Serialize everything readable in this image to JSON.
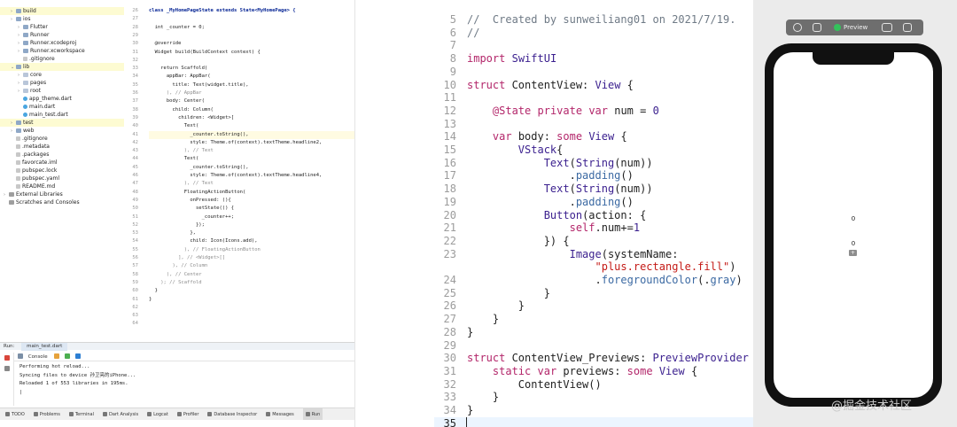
{
  "project_tree": [
    {
      "indent": 1,
      "arrow": "›",
      "icon": "folder",
      "label": "build",
      "selected": true
    },
    {
      "indent": 1,
      "arrow": "›",
      "icon": "folder",
      "label": "ios",
      "selected": false
    },
    {
      "indent": 2,
      "arrow": "›",
      "icon": "folder",
      "label": "Flutter",
      "selected": false
    },
    {
      "indent": 2,
      "arrow": "›",
      "icon": "folder",
      "label": "Runner",
      "selected": false
    },
    {
      "indent": 2,
      "arrow": "›",
      "icon": "folder",
      "label": "Runner.xcodeproj",
      "selected": false
    },
    {
      "indent": 2,
      "arrow": "›",
      "icon": "folder",
      "label": "Runner.xcworkspace",
      "selected": false
    },
    {
      "indent": 2,
      "arrow": "",
      "icon": "file",
      "label": ".gitignore",
      "selected": false
    },
    {
      "indent": 1,
      "arrow": "⌄",
      "icon": "folder",
      "label": "lib",
      "selected": true
    },
    {
      "indent": 2,
      "arrow": "›",
      "icon": "pkg",
      "label": "core",
      "selected": false
    },
    {
      "indent": 2,
      "arrow": "›",
      "icon": "pkg",
      "label": "pages",
      "selected": false
    },
    {
      "indent": 2,
      "arrow": "›",
      "icon": "pkg",
      "label": "root",
      "selected": false
    },
    {
      "indent": 2,
      "arrow": "",
      "icon": "dart",
      "label": "app_theme.dart",
      "selected": false
    },
    {
      "indent": 2,
      "arrow": "",
      "icon": "dart",
      "label": "main.dart",
      "selected": false
    },
    {
      "indent": 2,
      "arrow": "",
      "icon": "dart",
      "label": "main_test.dart",
      "selected": false
    },
    {
      "indent": 1,
      "arrow": "›",
      "icon": "folder",
      "label": "test",
      "selected": true
    },
    {
      "indent": 1,
      "arrow": "›",
      "icon": "folder",
      "label": "web",
      "selected": false
    },
    {
      "indent": 1,
      "arrow": "",
      "icon": "file",
      "label": ".gitignore",
      "selected": false
    },
    {
      "indent": 1,
      "arrow": "",
      "icon": "file",
      "label": ".metadata",
      "selected": false
    },
    {
      "indent": 1,
      "arrow": "",
      "icon": "file",
      "label": ".packages",
      "selected": false
    },
    {
      "indent": 1,
      "arrow": "",
      "icon": "file",
      "label": "favorcate.iml",
      "selected": false
    },
    {
      "indent": 1,
      "arrow": "",
      "icon": "file",
      "label": "pubspec.lock",
      "selected": false
    },
    {
      "indent": 1,
      "arrow": "",
      "icon": "file",
      "label": "pubspec.yaml",
      "selected": false
    },
    {
      "indent": 1,
      "arrow": "",
      "icon": "file",
      "label": "README.md",
      "selected": false
    },
    {
      "indent": 0,
      "arrow": "›",
      "icon": "lib",
      "label": "External Libraries",
      "selected": false
    },
    {
      "indent": 0,
      "arrow": "",
      "icon": "lib",
      "label": "Scratches and Consoles",
      "selected": false
    }
  ],
  "dart_editor": {
    "line_numbers": [
      "26",
      "27",
      "28",
      "29",
      "30",
      "31",
      "32",
      "33",
      "34",
      "35",
      "36",
      "37",
      "38",
      "39",
      "40",
      "41",
      "42",
      "43",
      "44",
      "45",
      "46",
      "47",
      "48",
      "49",
      "50",
      "51",
      "52",
      "53",
      "54",
      "55",
      "56",
      "57",
      "58",
      "59",
      "60",
      "61",
      "62",
      "63",
      "64"
    ],
    "lines": [
      {
        "text": "class _MyHomePageState extends State<MyHomePage> {",
        "style": "kw",
        "highlight": false
      },
      {
        "text": "",
        "style": "",
        "highlight": false
      },
      {
        "text": "  int _counter = 0;",
        "style": "",
        "highlight": false
      },
      {
        "text": "",
        "style": "",
        "highlight": false
      },
      {
        "text": "  @override",
        "style": "",
        "highlight": false
      },
      {
        "text": "  Widget build(BuildContext context) {",
        "style": "",
        "highlight": false
      },
      {
        "text": "",
        "style": "",
        "highlight": false
      },
      {
        "text": "    return Scaffold(",
        "style": "",
        "highlight": false
      },
      {
        "text": "      appBar: AppBar(",
        "style": "",
        "highlight": false
      },
      {
        "text": "        title: Text(widget.title),",
        "style": "",
        "highlight": false
      },
      {
        "text": "      ), // AppBar",
        "style": "cm",
        "highlight": false
      },
      {
        "text": "      body: Center(",
        "style": "",
        "highlight": false
      },
      {
        "text": "        child: Column(",
        "style": "",
        "highlight": false
      },
      {
        "text": "          children: <Widget>[",
        "style": "",
        "highlight": false
      },
      {
        "text": "            Text(",
        "style": "",
        "highlight": false
      },
      {
        "text": "              _counter.toString(),",
        "style": "",
        "highlight": true
      },
      {
        "text": "              style: Theme.of(context).textTheme.headline2,",
        "style": "",
        "highlight": false
      },
      {
        "text": "            ), // Text",
        "style": "cm",
        "highlight": false
      },
      {
        "text": "            Text(",
        "style": "",
        "highlight": false
      },
      {
        "text": "              _counter.toString(),",
        "style": "",
        "highlight": false
      },
      {
        "text": "              style: Theme.of(context).textTheme.headline4,",
        "style": "",
        "highlight": false
      },
      {
        "text": "            ), // Text",
        "style": "cm",
        "highlight": false
      },
      {
        "text": "            FloatingActionButton(",
        "style": "",
        "highlight": false
      },
      {
        "text": "              onPressed: (){",
        "style": "",
        "highlight": false
      },
      {
        "text": "                setState(() {",
        "style": "",
        "highlight": false
      },
      {
        "text": "                  _counter++;",
        "style": "",
        "highlight": false
      },
      {
        "text": "                });",
        "style": "",
        "highlight": false
      },
      {
        "text": "              },",
        "style": "",
        "highlight": false
      },
      {
        "text": "              child: Icon(Icons.add),",
        "style": "",
        "highlight": false
      },
      {
        "text": "            ), // FloatingActionButton",
        "style": "cm",
        "highlight": false
      },
      {
        "text": "          ], // <Widget>[]",
        "style": "cm",
        "highlight": false
      },
      {
        "text": "        ), // Column",
        "style": "cm",
        "highlight": false
      },
      {
        "text": "      ), // Center",
        "style": "cm",
        "highlight": false
      },
      {
        "text": "    ); // Scaffold",
        "style": "cm",
        "highlight": false
      },
      {
        "text": "  }",
        "style": "",
        "highlight": false
      },
      {
        "text": "}",
        "style": "",
        "highlight": false
      },
      {
        "text": "",
        "style": "",
        "highlight": false
      },
      {
        "text": "",
        "style": "",
        "highlight": false
      },
      {
        "text": "",
        "style": "",
        "highlight": false
      }
    ]
  },
  "run_panel": {
    "run_label": "Run:",
    "run_tab": "main_test.dart",
    "console_label": "Console",
    "console_lines": [
      "Performing hot reload...",
      "Syncing files to device 孙卫亮的iPhone...",
      "Reloaded 1 of 553 libraries in 195ms.",
      "|"
    ]
  },
  "bottom_tabs": [
    "TODO",
    "Problems",
    "Terminal",
    "Dart Analysis",
    "Logcat",
    "Profiler",
    "Database Inspector",
    "Messages",
    "Run"
  ],
  "bottom_active_tab": "Run",
  "swift_editor": {
    "lines": [
      {
        "num": "5",
        "text": "//  Created by sunweiliang01 on 2021/7/19."
      },
      {
        "num": "6",
        "text": "//"
      },
      {
        "num": "7",
        "text": ""
      },
      {
        "num": "8",
        "text": "import SwiftUI"
      },
      {
        "num": "9",
        "text": ""
      },
      {
        "num": "10",
        "text": "struct ContentView: View {"
      },
      {
        "num": "11",
        "text": ""
      },
      {
        "num": "12",
        "text": "    @State private var num = 0"
      },
      {
        "num": "13",
        "text": ""
      },
      {
        "num": "14",
        "text": "    var body: some View {"
      },
      {
        "num": "15",
        "text": "        VStack{"
      },
      {
        "num": "16",
        "text": "            Text(String(num))"
      },
      {
        "num": "17",
        "text": "                .padding()"
      },
      {
        "num": "18",
        "text": "            Text(String(num))"
      },
      {
        "num": "19",
        "text": "                .padding()"
      },
      {
        "num": "20",
        "text": "            Button(action: {"
      },
      {
        "num": "21",
        "text": "                self.num+=1"
      },
      {
        "num": "22",
        "text": "            }) {"
      },
      {
        "num": "23",
        "text": "                Image(systemName:"
      },
      {
        "num": "",
        "text": "                    \"plus.rectangle.fill\")"
      },
      {
        "num": "24",
        "text": "                    .foregroundColor(.gray)"
      },
      {
        "num": "25",
        "text": "            }"
      },
      {
        "num": "26",
        "text": "        }"
      },
      {
        "num": "27",
        "text": "    }"
      },
      {
        "num": "28",
        "text": "}"
      },
      {
        "num": "29",
        "text": ""
      },
      {
        "num": "30",
        "text": "struct ContentView_Previews: PreviewProvider {"
      },
      {
        "num": "31",
        "text": "    static var previews: some View {"
      },
      {
        "num": "32",
        "text": "        ContentView()"
      },
      {
        "num": "33",
        "text": "    }"
      },
      {
        "num": "34",
        "text": "}"
      },
      {
        "num": "35",
        "text": ""
      }
    ],
    "current_line": "35"
  },
  "preview": {
    "toolbar_label": "Preview",
    "counter_1": "0",
    "counter_2": "0",
    "plus_icon": "plus-rectangle-fill-icon"
  },
  "watermark": "@掘金技术社区",
  "colors": {
    "keyword": "#b3266a",
    "type": "#3a1f8e",
    "string": "#c41a16",
    "comment": "#6f7a86",
    "preview_green": "#33c25b",
    "selected_row": "#fdfbd2"
  }
}
